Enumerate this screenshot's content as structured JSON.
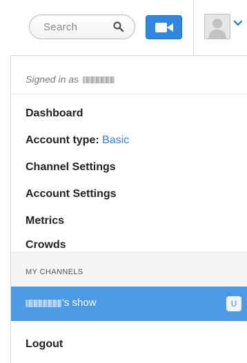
{
  "header": {
    "search_placeholder": "Search",
    "search_icon": "magnifier-icon",
    "camera_icon": "video-camera-icon",
    "avatar_icon": "default-user-avatar",
    "dropdown_icon": "chevron-down-icon",
    "accent_color": "#2e87e0"
  },
  "menu": {
    "signed_in_label": "Signed in as",
    "items": [
      {
        "label": "Dashboard"
      },
      {
        "label": "Account type:",
        "value": "Basic"
      },
      {
        "label": "Channel Settings"
      },
      {
        "label": "Account Settings"
      },
      {
        "label": "Metrics"
      },
      {
        "label": "Crowds"
      }
    ],
    "section_title": "MY CHANNELS",
    "channel": {
      "label": "'s show",
      "badge": "U",
      "highlight_color": "#4d99e6"
    },
    "logout_label": "Logout"
  }
}
